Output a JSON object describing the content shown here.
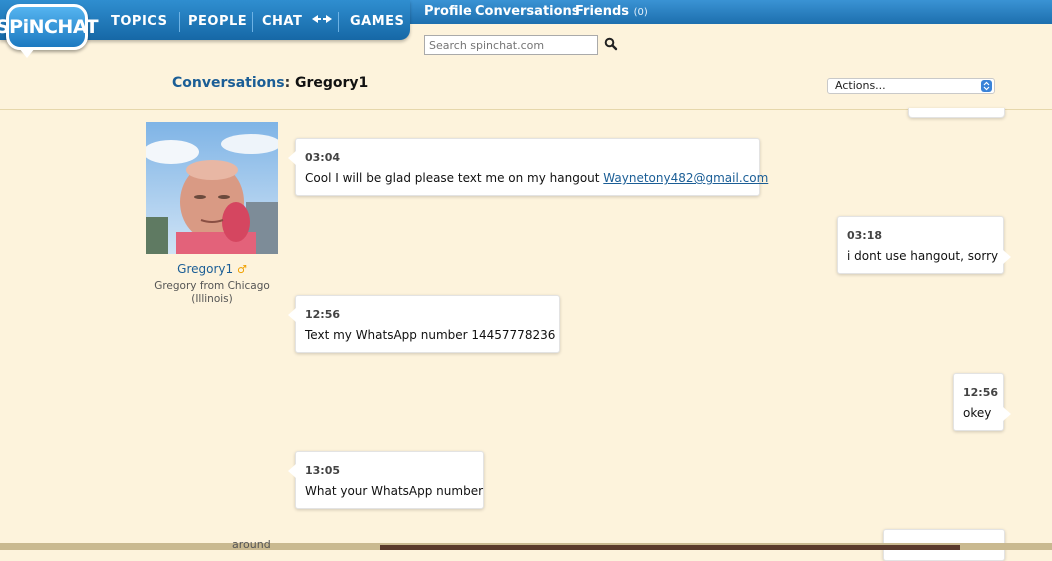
{
  "logo": {
    "text": "SPiNCHAT"
  },
  "nav": {
    "topics": "TOPICS",
    "people": "PEOPLE",
    "chat": "CHAT",
    "games": "GAMES"
  },
  "toplinks": {
    "profile": "Profile",
    "conversations": "Conversations",
    "friends": "Friends",
    "friends_count": "(0)"
  },
  "search": {
    "placeholder": "Search spinchat.com"
  },
  "header": {
    "label": "Conversations",
    "colon": ":",
    "contact": "Gregory1"
  },
  "actions": {
    "selected": "Actions..."
  },
  "profile": {
    "name": "Gregory1",
    "gender_icon": "male-symbol",
    "location": "Gregory from Chicago (Illinois)"
  },
  "messages": [
    {
      "side": "left",
      "time": "03:04",
      "text": "Cool I will be glad please text me on my hangout ",
      "link": "Waynetony482@gmail.com"
    },
    {
      "side": "right",
      "time": "03:18",
      "text": "i dont use hangout, sorry"
    },
    {
      "side": "left",
      "time": "12:56",
      "text": "Text my WhatsApp number 14457778236"
    },
    {
      "side": "right",
      "time": "12:56",
      "text": "okey"
    },
    {
      "side": "left",
      "time": "13:05",
      "text": "What your WhatsApp number"
    }
  ],
  "footer": {
    "partial_text": "around"
  },
  "colors": {
    "accent": "#1b5e96",
    "nav_blue": "#1668a6",
    "background": "#fdf3dc"
  }
}
